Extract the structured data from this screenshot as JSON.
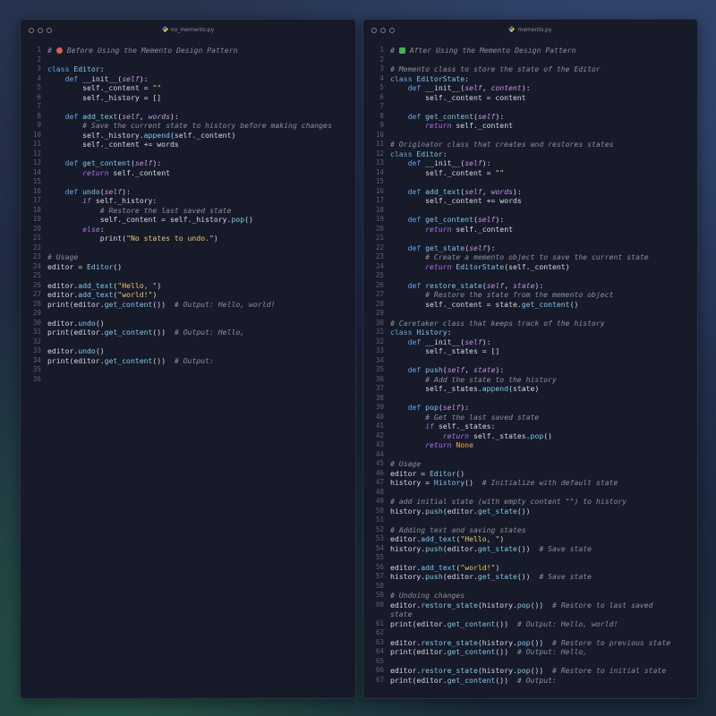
{
  "left": {
    "filename": "no_memento.py",
    "lines": [
      [
        [
          "c",
          "# "
        ],
        [
          "e",
          "no-entry"
        ],
        [
          "c",
          " Before Using the Memento Design Pattern"
        ]
      ],
      [],
      [
        [
          "k",
          "class "
        ],
        [
          "f",
          "Editor"
        ],
        [
          "t",
          ":"
        ]
      ],
      [
        [
          "t",
          "    "
        ],
        [
          "k",
          "def "
        ],
        [
          "t",
          "__init__("
        ],
        [
          "p",
          "self"
        ],
        [
          "t",
          "):"
        ]
      ],
      [
        [
          "t",
          "        self._content = "
        ],
        [
          "s",
          "\"\""
        ]
      ],
      [
        [
          "t",
          "        self._history = []"
        ]
      ],
      [],
      [
        [
          "t",
          "    "
        ],
        [
          "k",
          "def "
        ],
        [
          "f",
          "add_text"
        ],
        [
          "t",
          "("
        ],
        [
          "p",
          "self"
        ],
        [
          "t",
          ", "
        ],
        [
          "p",
          "words"
        ],
        [
          "t",
          "):"
        ]
      ],
      [
        [
          "t",
          "        "
        ],
        [
          "c",
          "# Save the current state to history before making changes"
        ]
      ],
      [
        [
          "t",
          "        self._history."
        ],
        [
          "f",
          "append"
        ],
        [
          "t",
          "(self._content)"
        ]
      ],
      [
        [
          "t",
          "        self._content += words"
        ]
      ],
      [],
      [
        [
          "t",
          "    "
        ],
        [
          "k",
          "def "
        ],
        [
          "f",
          "get_content"
        ],
        [
          "t",
          "("
        ],
        [
          "p",
          "self"
        ],
        [
          "t",
          "):"
        ]
      ],
      [
        [
          "t",
          "        "
        ],
        [
          "r",
          "return"
        ],
        [
          "t",
          " self._content"
        ]
      ],
      [],
      [
        [
          "t",
          "    "
        ],
        [
          "k",
          "def "
        ],
        [
          "f",
          "undo"
        ],
        [
          "t",
          "("
        ],
        [
          "p",
          "self"
        ],
        [
          "t",
          "):"
        ]
      ],
      [
        [
          "t",
          "        "
        ],
        [
          "r",
          "if"
        ],
        [
          "t",
          " self._history:"
        ]
      ],
      [
        [
          "t",
          "            "
        ],
        [
          "c",
          "# Restore the last saved state"
        ]
      ],
      [
        [
          "t",
          "            self._content = self._history."
        ],
        [
          "f",
          "pop"
        ],
        [
          "t",
          "()"
        ]
      ],
      [
        [
          "t",
          "        "
        ],
        [
          "r",
          "else"
        ],
        [
          "t",
          ":"
        ]
      ],
      [
        [
          "t",
          "            print("
        ],
        [
          "s",
          "\"No states to undo.\""
        ],
        [
          "t",
          ")"
        ]
      ],
      [],
      [
        [
          "c",
          "# Usage"
        ]
      ],
      [
        [
          "t",
          "editor = "
        ],
        [
          "f",
          "Editor"
        ],
        [
          "t",
          "()"
        ]
      ],
      [],
      [
        [
          "t",
          "editor."
        ],
        [
          "f",
          "add_text"
        ],
        [
          "t",
          "("
        ],
        [
          "s",
          "\"Hello, \""
        ],
        [
          "t",
          ")"
        ]
      ],
      [
        [
          "t",
          "editor."
        ],
        [
          "f",
          "add_text"
        ],
        [
          "t",
          "("
        ],
        [
          "s",
          "\"world!\""
        ],
        [
          "t",
          ")"
        ]
      ],
      [
        [
          "t",
          "print(editor."
        ],
        [
          "f",
          "get_content"
        ],
        [
          "t",
          "())  "
        ],
        [
          "c",
          "# Output: Hello, world!"
        ]
      ],
      [],
      [
        [
          "t",
          "editor."
        ],
        [
          "f",
          "undo"
        ],
        [
          "t",
          "()"
        ]
      ],
      [
        [
          "t",
          "print(editor."
        ],
        [
          "f",
          "get_content"
        ],
        [
          "t",
          "())  "
        ],
        [
          "c",
          "# Output: Hello,"
        ]
      ],
      [],
      [
        [
          "t",
          "editor."
        ],
        [
          "f",
          "undo"
        ],
        [
          "t",
          "()"
        ]
      ],
      [
        [
          "t",
          "print(editor."
        ],
        [
          "f",
          "get_content"
        ],
        [
          "t",
          "())  "
        ],
        [
          "c",
          "# Output:"
        ]
      ],
      [],
      []
    ]
  },
  "right": {
    "filename": "memento.py",
    "lines": [
      [
        [
          "c",
          "# "
        ],
        [
          "e",
          "check"
        ],
        [
          "c",
          " After Using the Memento Design Pattern"
        ]
      ],
      [],
      [
        [
          "c",
          "# Memento class to store the state of the Editor"
        ]
      ],
      [
        [
          "k",
          "class "
        ],
        [
          "f",
          "EditorState"
        ],
        [
          "t",
          ":"
        ]
      ],
      [
        [
          "t",
          "    "
        ],
        [
          "k",
          "def "
        ],
        [
          "t",
          "__init__("
        ],
        [
          "p",
          "self"
        ],
        [
          "t",
          ", "
        ],
        [
          "p",
          "content"
        ],
        [
          "t",
          "):"
        ]
      ],
      [
        [
          "t",
          "        self._content = content"
        ]
      ],
      [],
      [
        [
          "t",
          "    "
        ],
        [
          "k",
          "def "
        ],
        [
          "f",
          "get_content"
        ],
        [
          "t",
          "("
        ],
        [
          "p",
          "self"
        ],
        [
          "t",
          "):"
        ]
      ],
      [
        [
          "t",
          "        "
        ],
        [
          "r",
          "return"
        ],
        [
          "t",
          " self._content"
        ]
      ],
      [],
      [
        [
          "c",
          "# Originator class that creates and restores states"
        ]
      ],
      [
        [
          "k",
          "class "
        ],
        [
          "f",
          "Editor"
        ],
        [
          "t",
          ":"
        ]
      ],
      [
        [
          "t",
          "    "
        ],
        [
          "k",
          "def "
        ],
        [
          "t",
          "__init__("
        ],
        [
          "p",
          "self"
        ],
        [
          "t",
          "):"
        ]
      ],
      [
        [
          "t",
          "        self._content = "
        ],
        [
          "s",
          "\"\""
        ]
      ],
      [],
      [
        [
          "t",
          "    "
        ],
        [
          "k",
          "def "
        ],
        [
          "f",
          "add_text"
        ],
        [
          "t",
          "("
        ],
        [
          "p",
          "self"
        ],
        [
          "t",
          ", "
        ],
        [
          "p",
          "words"
        ],
        [
          "t",
          "):"
        ]
      ],
      [
        [
          "t",
          "        self._content += words"
        ]
      ],
      [],
      [
        [
          "t",
          "    "
        ],
        [
          "k",
          "def "
        ],
        [
          "f",
          "get_content"
        ],
        [
          "t",
          "("
        ],
        [
          "p",
          "self"
        ],
        [
          "t",
          "):"
        ]
      ],
      [
        [
          "t",
          "        "
        ],
        [
          "r",
          "return"
        ],
        [
          "t",
          " self._content"
        ]
      ],
      [],
      [
        [
          "t",
          "    "
        ],
        [
          "k",
          "def "
        ],
        [
          "f",
          "get_state"
        ],
        [
          "t",
          "("
        ],
        [
          "p",
          "self"
        ],
        [
          "t",
          "):"
        ]
      ],
      [
        [
          "t",
          "        "
        ],
        [
          "c",
          "# Create a memento object to save the current state"
        ]
      ],
      [
        [
          "t",
          "        "
        ],
        [
          "r",
          "return "
        ],
        [
          "f",
          "EditorState"
        ],
        [
          "t",
          "(self._content)"
        ]
      ],
      [],
      [
        [
          "t",
          "    "
        ],
        [
          "k",
          "def "
        ],
        [
          "f",
          "restore_state"
        ],
        [
          "t",
          "("
        ],
        [
          "p",
          "self"
        ],
        [
          "t",
          ", "
        ],
        [
          "p",
          "state"
        ],
        [
          "t",
          "):"
        ]
      ],
      [
        [
          "t",
          "        "
        ],
        [
          "c",
          "# Restore the state from the memento object"
        ]
      ],
      [
        [
          "t",
          "        self._content = state."
        ],
        [
          "f",
          "get_content"
        ],
        [
          "t",
          "()"
        ]
      ],
      [],
      [
        [
          "c",
          "# Caretaker class that keeps track of the history"
        ]
      ],
      [
        [
          "k",
          "class "
        ],
        [
          "f",
          "History"
        ],
        [
          "t",
          ":"
        ]
      ],
      [
        [
          "t",
          "    "
        ],
        [
          "k",
          "def "
        ],
        [
          "t",
          "__init__("
        ],
        [
          "p",
          "self"
        ],
        [
          "t",
          "):"
        ]
      ],
      [
        [
          "t",
          "        self._states = []"
        ]
      ],
      [],
      [
        [
          "t",
          "    "
        ],
        [
          "k",
          "def "
        ],
        [
          "f",
          "push"
        ],
        [
          "t",
          "("
        ],
        [
          "p",
          "self"
        ],
        [
          "t",
          ", "
        ],
        [
          "p",
          "state"
        ],
        [
          "t",
          "):"
        ]
      ],
      [
        [
          "t",
          "        "
        ],
        [
          "c",
          "# Add the state to the history"
        ]
      ],
      [
        [
          "t",
          "        self._states."
        ],
        [
          "f",
          "append"
        ],
        [
          "t",
          "(state)"
        ]
      ],
      [],
      [
        [
          "t",
          "    "
        ],
        [
          "k",
          "def "
        ],
        [
          "f",
          "pop"
        ],
        [
          "t",
          "("
        ],
        [
          "p",
          "self"
        ],
        [
          "t",
          "):"
        ]
      ],
      [
        [
          "t",
          "        "
        ],
        [
          "c",
          "# Get the last saved state"
        ]
      ],
      [
        [
          "t",
          "        "
        ],
        [
          "r",
          "if"
        ],
        [
          "t",
          " self._states:"
        ]
      ],
      [
        [
          "t",
          "            "
        ],
        [
          "r",
          "return"
        ],
        [
          "t",
          " self._states."
        ],
        [
          "f",
          "pop"
        ],
        [
          "t",
          "()"
        ]
      ],
      [
        [
          "t",
          "        "
        ],
        [
          "r",
          "return "
        ],
        [
          "x",
          "None"
        ]
      ],
      [],
      [
        [
          "c",
          "# Usage"
        ]
      ],
      [
        [
          "t",
          "editor = "
        ],
        [
          "f",
          "Editor"
        ],
        [
          "t",
          "()"
        ]
      ],
      [
        [
          "t",
          "history = "
        ],
        [
          "f",
          "History"
        ],
        [
          "t",
          "()  "
        ],
        [
          "c",
          "# Initialize with default state"
        ]
      ],
      [],
      [
        [
          "c",
          "# add initial state (with empty content \"\") to history"
        ]
      ],
      [
        [
          "t",
          "history."
        ],
        [
          "f",
          "push"
        ],
        [
          "t",
          "(editor."
        ],
        [
          "f",
          "get_state"
        ],
        [
          "t",
          "())"
        ]
      ],
      [],
      [
        [
          "c",
          "# Adding text and saving states"
        ]
      ],
      [
        [
          "t",
          "editor."
        ],
        [
          "f",
          "add_text"
        ],
        [
          "t",
          "("
        ],
        [
          "s",
          "\"Hello, \""
        ],
        [
          "t",
          ")"
        ]
      ],
      [
        [
          "t",
          "history."
        ],
        [
          "f",
          "push"
        ],
        [
          "t",
          "(editor."
        ],
        [
          "f",
          "get_state"
        ],
        [
          "t",
          "())  "
        ],
        [
          "c",
          "# Save state"
        ]
      ],
      [],
      [
        [
          "t",
          "editor."
        ],
        [
          "f",
          "add_text"
        ],
        [
          "t",
          "("
        ],
        [
          "s",
          "\"world!\""
        ],
        [
          "t",
          ")"
        ]
      ],
      [
        [
          "t",
          "history."
        ],
        [
          "f",
          "push"
        ],
        [
          "t",
          "(editor."
        ],
        [
          "f",
          "get_state"
        ],
        [
          "t",
          "())  "
        ],
        [
          "c",
          "# Save state"
        ]
      ],
      [],
      [
        [
          "c",
          "# Undoing changes"
        ]
      ],
      [
        [
          "t",
          "editor."
        ],
        [
          "f",
          "restore_state"
        ],
        [
          "t",
          "(history."
        ],
        [
          "f",
          "pop"
        ],
        [
          "t",
          "())  "
        ],
        [
          "c",
          "# Restore to last saved"
        ]
      ],
      [
        [
          "c",
          "state"
        ]
      ],
      [
        [
          "t",
          "print(editor."
        ],
        [
          "f",
          "get_content"
        ],
        [
          "t",
          "())  "
        ],
        [
          "c",
          "# Output: Hello, world!"
        ]
      ],
      [],
      [
        [
          "t",
          "editor."
        ],
        [
          "f",
          "restore_state"
        ],
        [
          "t",
          "(history."
        ],
        [
          "f",
          "pop"
        ],
        [
          "t",
          "())  "
        ],
        [
          "c",
          "# Restore to previous state"
        ]
      ],
      [
        [
          "t",
          "print(editor."
        ],
        [
          "f",
          "get_content"
        ],
        [
          "t",
          "())  "
        ],
        [
          "c",
          "# Output: Hello,"
        ]
      ],
      [],
      [
        [
          "t",
          "editor."
        ],
        [
          "f",
          "restore_state"
        ],
        [
          "t",
          "(history."
        ],
        [
          "f",
          "pop"
        ],
        [
          "t",
          "())  "
        ],
        [
          "c",
          "# Restore to initial state"
        ]
      ],
      [
        [
          "t",
          "print(editor."
        ],
        [
          "f",
          "get_content"
        ],
        [
          "t",
          "())  "
        ],
        [
          "c",
          "# Output:"
        ]
      ]
    ],
    "numbers": [
      "1",
      "2",
      "3",
      "4",
      "5",
      "6",
      "7",
      "8",
      "9",
      "10",
      "11",
      "12",
      "13",
      "14",
      "15",
      "16",
      "17",
      "18",
      "19",
      "20",
      "21",
      "22",
      "23",
      "24",
      "25",
      "26",
      "27",
      "28",
      "29",
      "30",
      "31",
      "32",
      "33",
      "34",
      "35",
      "36",
      "37",
      "38",
      "39",
      "40",
      "41",
      "42",
      "43",
      "44",
      "45",
      "46",
      "47",
      "48",
      "49",
      "50",
      "51",
      "52",
      "53",
      "54",
      "55",
      "56",
      "57",
      "58",
      "59",
      "60",
      "",
      "61",
      "62",
      "63",
      "64",
      "65",
      "66",
      "67"
    ]
  }
}
